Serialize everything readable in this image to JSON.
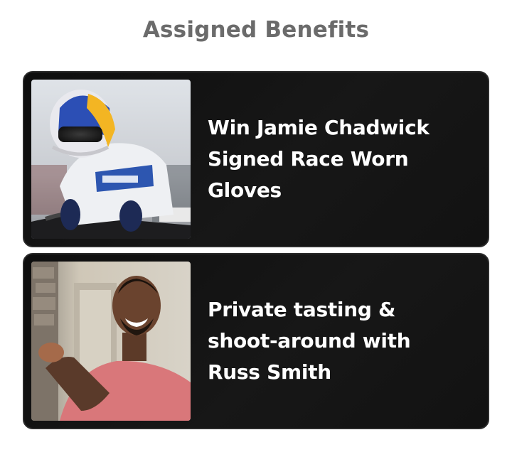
{
  "header": {
    "title": "Assigned Benefits"
  },
  "benefits": [
    {
      "label": "Win Jamie Chadwick Signed Race Worn Gloves",
      "image_subject": "racing-driver-photo"
    },
    {
      "label": "Private tasting & shoot-around with Russ Smith",
      "image_subject": "smiling-man-portrait-photo"
    }
  ]
}
